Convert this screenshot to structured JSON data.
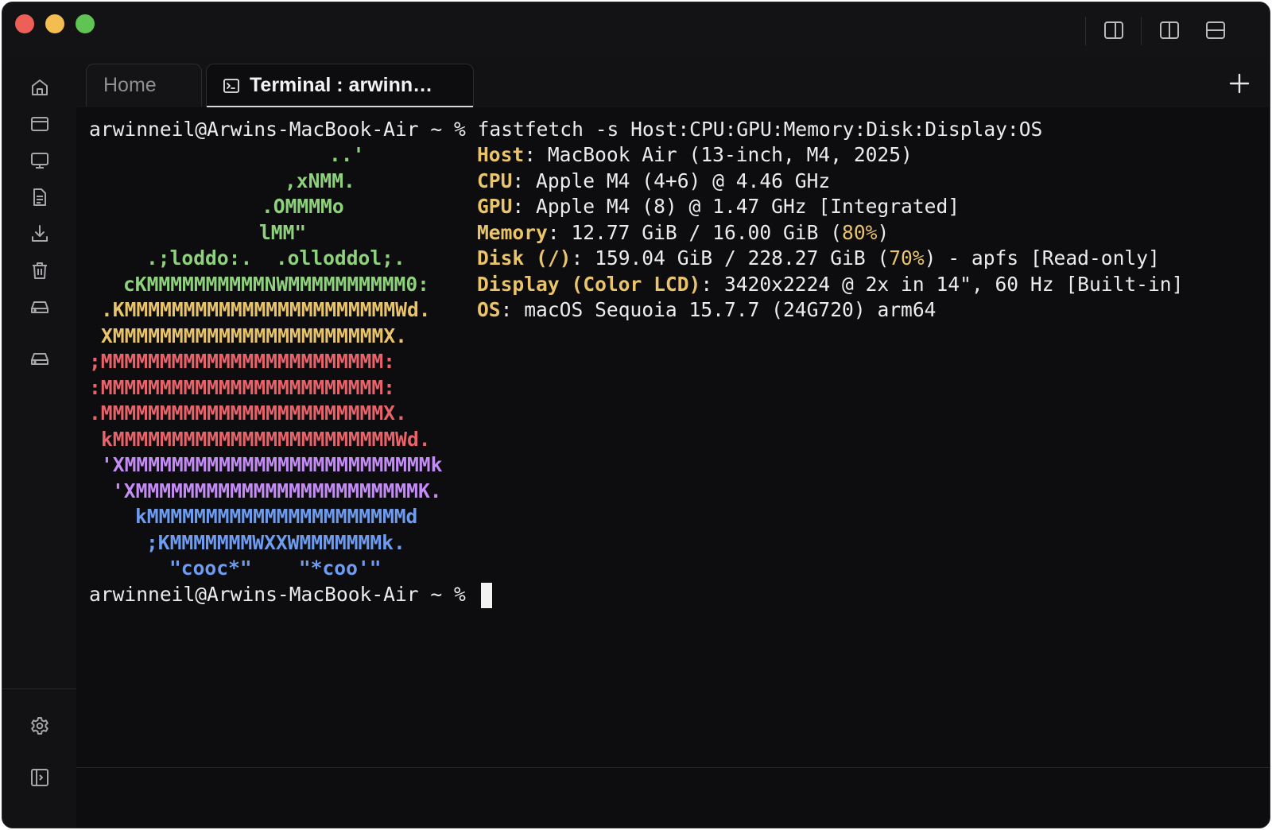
{
  "window": {
    "traffic_lights": {
      "close": "#ed5f57",
      "minimize": "#f4bd4f",
      "zoom": "#5fc454"
    },
    "toolbar_icons": [
      "sidebar-right-icon",
      "split-vertical-icon",
      "split-horizontal-icon"
    ]
  },
  "sidebar": {
    "items": [
      {
        "icon": "home-icon"
      },
      {
        "icon": "window-icon"
      },
      {
        "icon": "monitor-icon"
      },
      {
        "icon": "document-icon"
      },
      {
        "icon": "download-icon"
      },
      {
        "icon": "trash-icon"
      },
      {
        "icon": "drive-icon"
      },
      {
        "icon": "drive-icon"
      }
    ],
    "bottom_items": [
      {
        "icon": "gear-icon"
      },
      {
        "icon": "sidebar-toggle-icon"
      }
    ]
  },
  "tabs": [
    {
      "label": "Home",
      "active": false
    },
    {
      "label": "Terminal : arwinn…",
      "active": true,
      "icon": "terminal-icon"
    }
  ],
  "terminal": {
    "command_prompt": "arwinneil@Arwins-MacBook-Air ~ % ",
    "command": "fastfetch -s Host:CPU:GPU:Memory:Disk:Display:OS",
    "logo_lines": [
      {
        "text": "..'",
        "color": "green"
      },
      {
        "text": ",xNMM.",
        "color": "green"
      },
      {
        "text": ".OMMMMo",
        "color": "green"
      },
      {
        "text": "lMM\"",
        "color": "green"
      },
      {
        "text": ".;loddo:.  .olloddol;.",
        "color": "green"
      },
      {
        "text": "cKMMMMMMMMMMNWMMMMMMMMMM0:",
        "color": "green"
      },
      {
        "text": ".KMMMMMMMMMMMMMMMMMMMMMMMWd.",
        "color": "yellow"
      },
      {
        "text": "XMMMMMMMMMMMMMMMMMMMMMMMX.",
        "color": "yellow"
      },
      {
        "text": ";MMMMMMMMMMMMMMMMMMMMMMMM:",
        "color": "red"
      },
      {
        "text": ":MMMMMMMMMMMMMMMMMMMMMMMM:",
        "color": "red"
      },
      {
        "text": ".MMMMMMMMMMMMMMMMMMMMMMMMX.",
        "color": "red"
      },
      {
        "text": "kMMMMMMMMMMMMMMMMMMMMMMMMWd.",
        "color": "red"
      },
      {
        "text": "'XMMMMMMMMMMMMMMMMMMMMMMMMMMk",
        "color": "purple"
      },
      {
        "text": "'XMMMMMMMMMMMMMMMMMMMMMMMMK.",
        "color": "purple"
      },
      {
        "text": "kMMMMMMMMMMMMMMMMMMMMMMd",
        "color": "blue"
      },
      {
        "text": ";KMMMMMMMWXXWMMMMMMMk.",
        "color": "blue"
      },
      {
        "text": "\"cooc*\"    \"*coo'\"",
        "color": "blue"
      }
    ],
    "info": {
      "host_key": "Host",
      "host_value": ": MacBook Air (13-inch, M4, 2025)",
      "cpu_key": "CPU",
      "cpu_value": ": Apple M4 (4+6) @ 4.46 GHz",
      "gpu_key": "GPU",
      "gpu_value": ": Apple M4 (8) @ 1.47 GHz [Integrated]",
      "memory_key": "Memory",
      "memory_value": ": 12.77 GiB / 16.00 GiB (",
      "memory_pct": "80%",
      "memory_tail": ")",
      "disk_key": "Disk (/)",
      "disk_value": ": 159.04 GiB / 228.27 GiB (",
      "disk_pct": "70%",
      "disk_tail": ") - apfs [Read-only]",
      "display_key": "Display (Color LCD)",
      "display_value": ": 3420x2224 @ 2x in 14\", 60 Hz [Built-in]",
      "os_key": "OS",
      "os_value": ": macOS Sequoia 15.7.7 (24G720) arm64"
    },
    "final_prompt": "arwinneil@Arwins-MacBook-Air ~ % "
  }
}
